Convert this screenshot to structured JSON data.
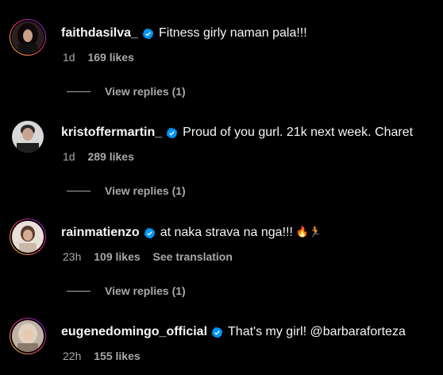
{
  "comments": [
    {
      "username": "faithdasilva_",
      "text": "Fitness girly naman pala!!!",
      "time": "1d",
      "likes": "169 likes",
      "view_replies": "View replies (1)"
    },
    {
      "username": "kristoffermartin_",
      "text": "Proud of you gurl. 21k next week. Charet",
      "time": "1d",
      "likes": "289 likes",
      "view_replies": "View replies (1)"
    },
    {
      "username": "rainmatienzo",
      "text": "at naka strava na nga!!!",
      "emojis": "🔥🏃",
      "time": "23h",
      "likes": "109 likes",
      "see_translation": "See translation",
      "view_replies": "View replies (1)"
    },
    {
      "username": "eugenedomingo_official",
      "text": "That's my girl! @barbaraforteza",
      "time": "22h",
      "likes": "155 likes"
    }
  ],
  "colors": {
    "background": "#000000",
    "primary_text": "#f5f5f5",
    "secondary_text": "#a8a8a8",
    "verified_badge": "#0095f6"
  },
  "icons": {
    "verified": "verified-badge-icon",
    "fire": "fire-emoji",
    "runner": "runner-emoji"
  }
}
